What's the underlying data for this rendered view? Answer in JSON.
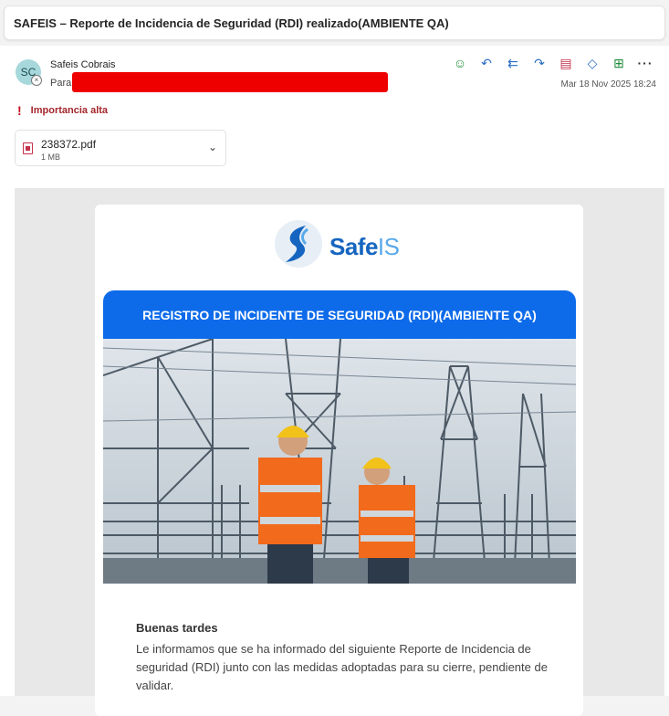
{
  "subject": "SAFEIS – Reporte de Incidencia de Seguridad (RDI) realizado(AMBIENTE QA)",
  "sender": {
    "initials": "SC",
    "name": "Safeis Cobrais",
    "to_label": "Para:"
  },
  "date": "Mar 18 Nov 2025 18:24",
  "importance": "Importancia alta",
  "attachment": {
    "name": "238372.pdf",
    "size": "1 MB"
  },
  "toolbar": {
    "icons": [
      "emoji-icon",
      "reply-icon",
      "reply-all-icon",
      "forward-icon",
      "report-icon",
      "tag-icon",
      "apps-icon",
      "more-icon"
    ]
  },
  "email": {
    "logo_safe": "Safe",
    "logo_is": "IS",
    "banner": "REGISTRO DE INCIDENTE DE SEGURIDAD (RDI)(AMBIENTE QA)",
    "greeting": "Buenas tardes",
    "paragraph": "Le informamos que se ha informado del siguiente Reporte de Incidencia de seguridad (RDI) junto con las medidas adoptadas para su cierre, pendiente de validar."
  },
  "colors": {
    "banner": "#0d6bea",
    "brand_dark": "#1565c0",
    "brand_light": "#5aa9ea",
    "importance": "#a4262c",
    "vest": "#f26a1b",
    "helmet": "#f2c21a"
  }
}
